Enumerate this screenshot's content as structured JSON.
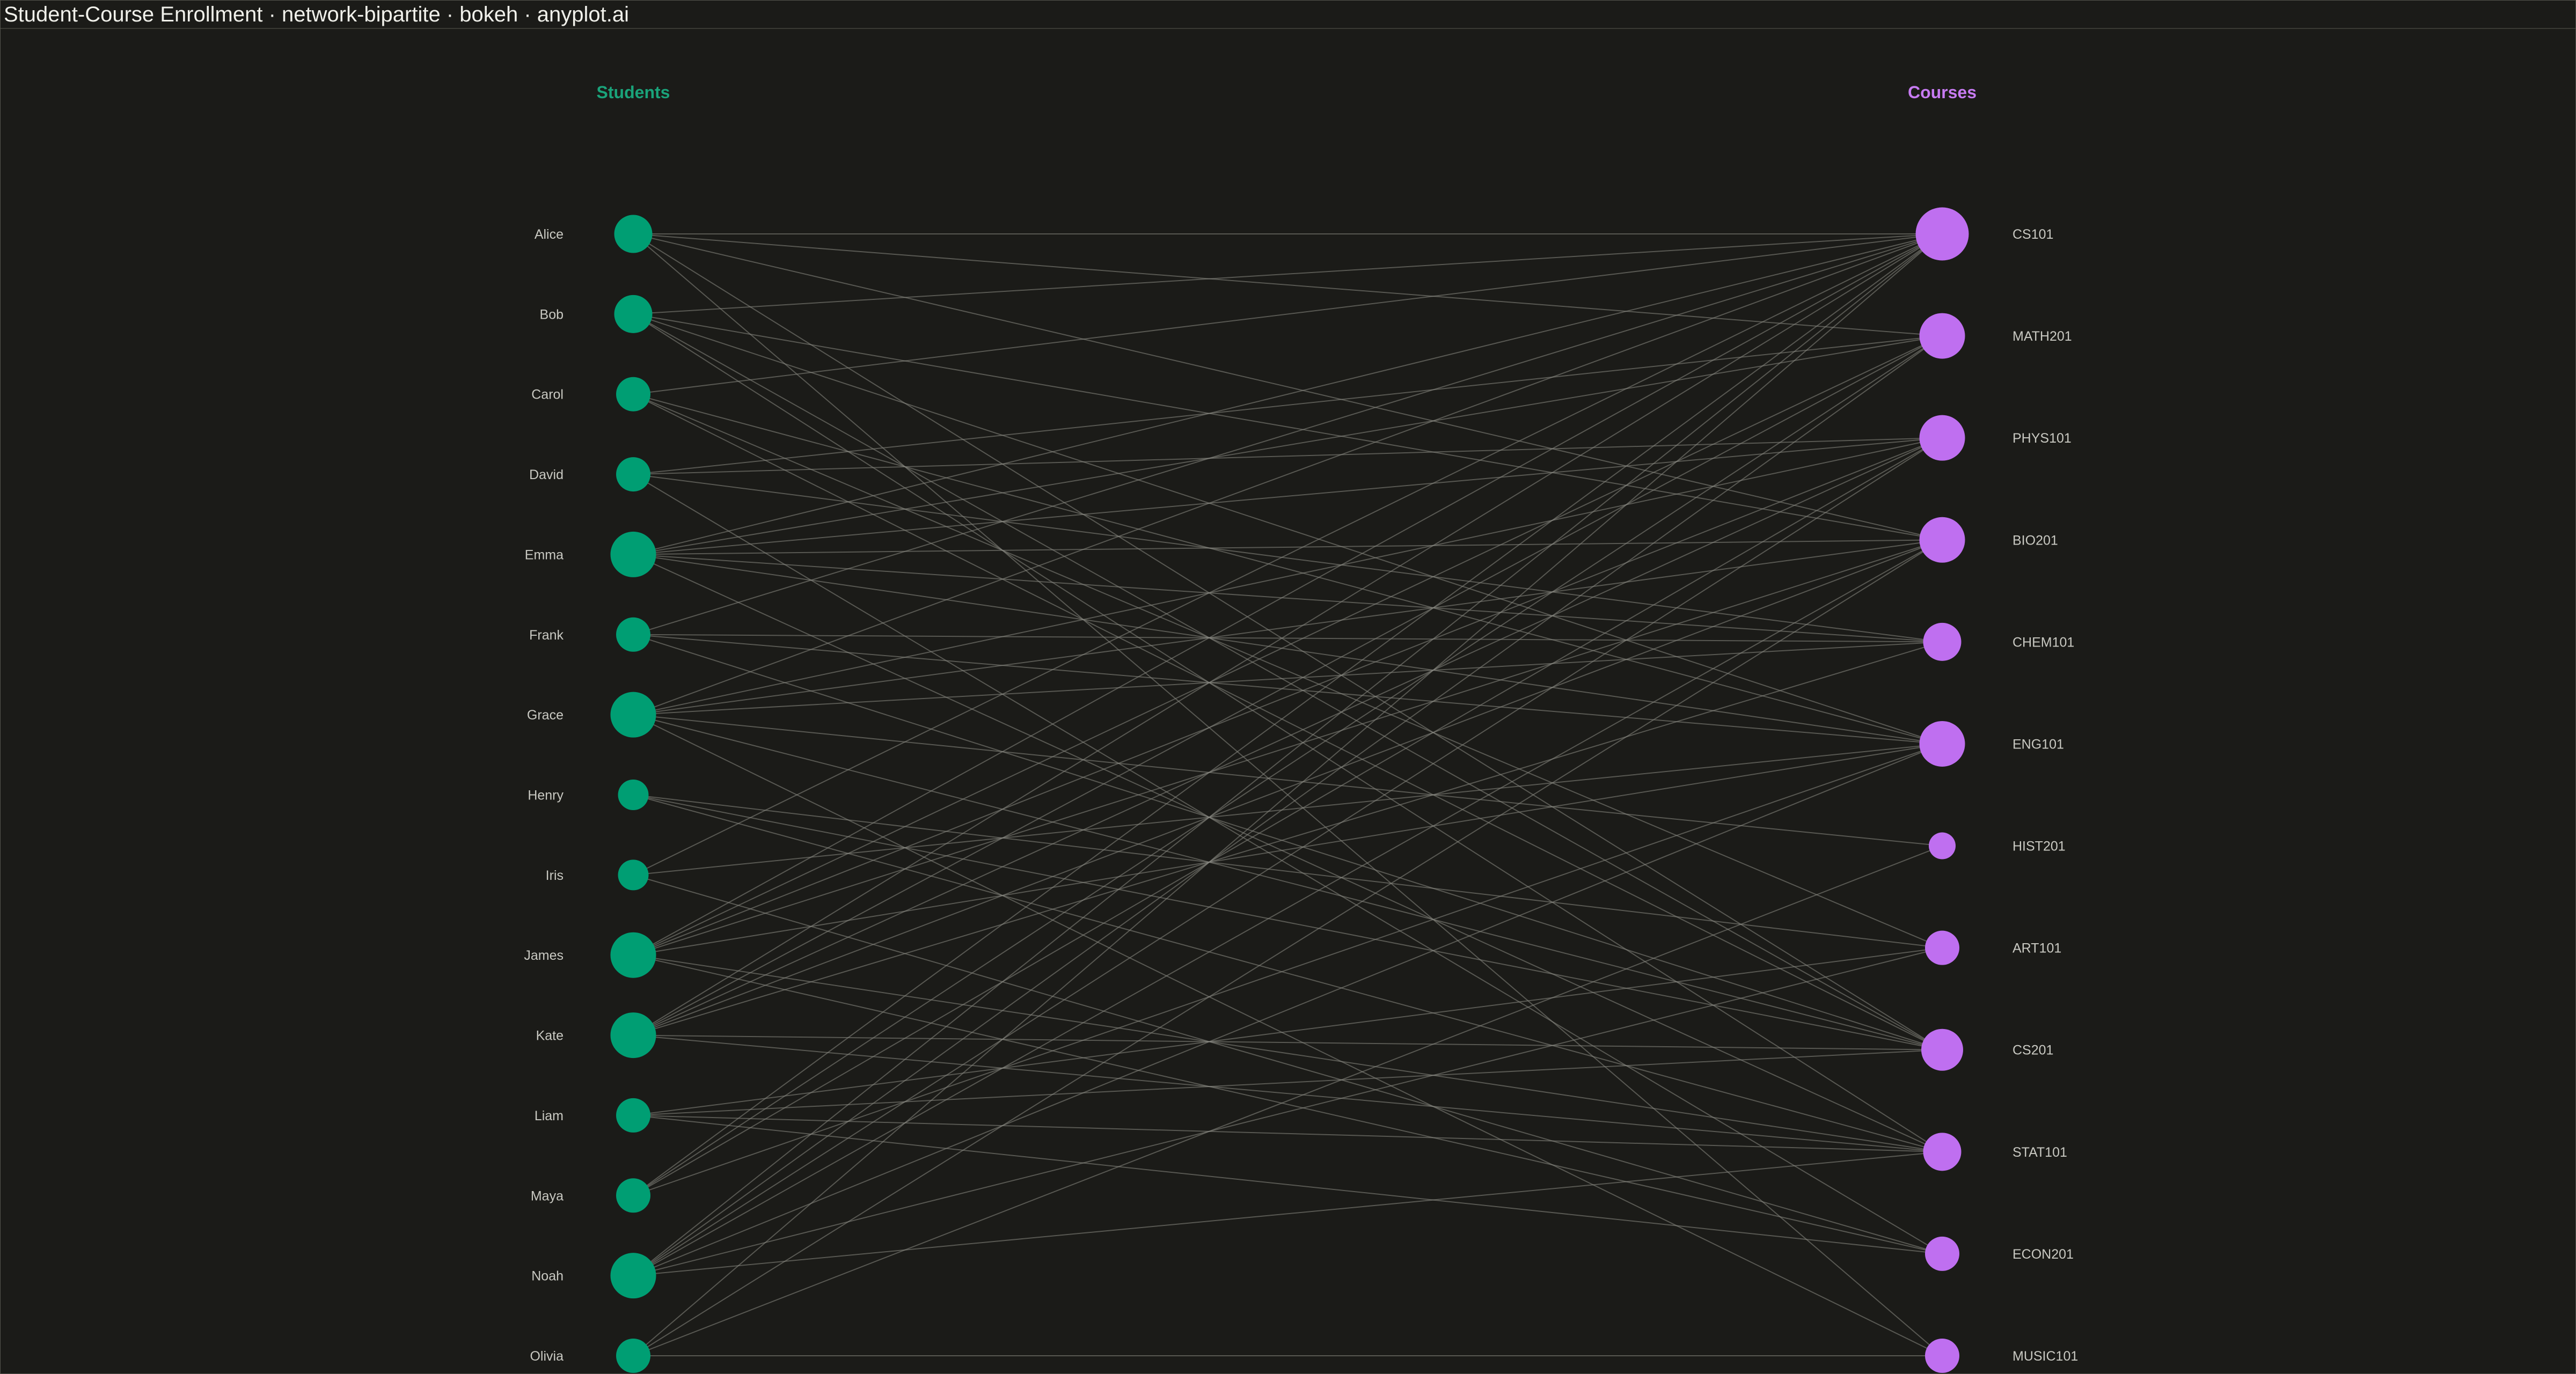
{
  "title": "Student-Course Enrollment · network-bipartite · bokeh · anyplot.ai",
  "colors": {
    "background": "#1b1b18",
    "student_node": "#009e73",
    "course_node": "#bf6ff0",
    "student_title": "#1aa37a",
    "course_title": "#c77bf2",
    "edge": "#8a8a84",
    "label": "#c9c9c2"
  },
  "students": {
    "title": "Students",
    "nodes": [
      {
        "name": "Alice",
        "degree": 5
      },
      {
        "name": "Bob",
        "degree": 5
      },
      {
        "name": "Carol",
        "degree": 4
      },
      {
        "name": "David",
        "degree": 4
      },
      {
        "name": "Emma",
        "degree": 7
      },
      {
        "name": "Frank",
        "degree": 4
      },
      {
        "name": "Grace",
        "degree": 7
      },
      {
        "name": "Henry",
        "degree": 3
      },
      {
        "name": "Iris",
        "degree": 3
      },
      {
        "name": "James",
        "degree": 7
      },
      {
        "name": "Kate",
        "degree": 7
      },
      {
        "name": "Liam",
        "degree": 4
      },
      {
        "name": "Maya",
        "degree": 4
      },
      {
        "name": "Noah",
        "degree": 7
      },
      {
        "name": "Olivia",
        "degree": 4
      }
    ]
  },
  "courses": {
    "title": "Courses",
    "nodes": [
      {
        "name": "CS101",
        "degree": 9
      },
      {
        "name": "MATH201",
        "degree": 7
      },
      {
        "name": "PHYS101",
        "degree": 7
      },
      {
        "name": "BIO201",
        "degree": 7
      },
      {
        "name": "CHEM101",
        "degree": 5
      },
      {
        "name": "ENG101",
        "degree": 7
      },
      {
        "name": "HIST201",
        "degree": 2
      },
      {
        "name": "ART101",
        "degree": 4
      },
      {
        "name": "CS201",
        "degree": 6
      },
      {
        "name": "STAT101",
        "degree": 5
      },
      {
        "name": "ECON201",
        "degree": 4
      },
      {
        "name": "MUSIC101",
        "degree": 4
      }
    ]
  },
  "edges": [
    [
      "Alice",
      "CS101"
    ],
    [
      "Alice",
      "MATH201"
    ],
    [
      "Alice",
      "BIO201"
    ],
    [
      "Alice",
      "CS201"
    ],
    [
      "Alice",
      "MUSIC101"
    ],
    [
      "Bob",
      "CS101"
    ],
    [
      "Bob",
      "BIO201"
    ],
    [
      "Bob",
      "ENG101"
    ],
    [
      "Bob",
      "CS201"
    ],
    [
      "Bob",
      "STAT101"
    ],
    [
      "Carol",
      "CS101"
    ],
    [
      "Carol",
      "ENG101"
    ],
    [
      "Carol",
      "ART101"
    ],
    [
      "Carol",
      "CS201"
    ],
    [
      "David",
      "MATH201"
    ],
    [
      "David",
      "PHYS101"
    ],
    [
      "David",
      "CHEM101"
    ],
    [
      "David",
      "ECON201"
    ],
    [
      "Emma",
      "CS101"
    ],
    [
      "Emma",
      "MATH201"
    ],
    [
      "Emma",
      "PHYS101"
    ],
    [
      "Emma",
      "BIO201"
    ],
    [
      "Emma",
      "CHEM101"
    ],
    [
      "Emma",
      "ENG101"
    ],
    [
      "Emma",
      "STAT101"
    ],
    [
      "Frank",
      "CS101"
    ],
    [
      "Frank",
      "CHEM101"
    ],
    [
      "Frank",
      "ENG101"
    ],
    [
      "Frank",
      "CS201"
    ],
    [
      "Grace",
      "CS101"
    ],
    [
      "Grace",
      "PHYS101"
    ],
    [
      "Grace",
      "BIO201"
    ],
    [
      "Grace",
      "CHEM101"
    ],
    [
      "Grace",
      "HIST201"
    ],
    [
      "Grace",
      "CS201"
    ],
    [
      "Grace",
      "MUSIC101"
    ],
    [
      "Henry",
      "ART101"
    ],
    [
      "Henry",
      "CS201"
    ],
    [
      "Henry",
      "STAT101"
    ],
    [
      "Iris",
      "CS101"
    ],
    [
      "Iris",
      "ENG101"
    ],
    [
      "Iris",
      "ECON201"
    ],
    [
      "James",
      "CS101"
    ],
    [
      "James",
      "MATH201"
    ],
    [
      "James",
      "PHYS101"
    ],
    [
      "James",
      "BIO201"
    ],
    [
      "James",
      "ENG101"
    ],
    [
      "James",
      "STAT101"
    ],
    [
      "James",
      "ECON201"
    ],
    [
      "Kate",
      "CS101"
    ],
    [
      "Kate",
      "MATH201"
    ],
    [
      "Kate",
      "PHYS101"
    ],
    [
      "Kate",
      "BIO201"
    ],
    [
      "Kate",
      "CHEM101"
    ],
    [
      "Kate",
      "CS201"
    ],
    [
      "Kate",
      "STAT101"
    ],
    [
      "Liam",
      "ART101"
    ],
    [
      "Liam",
      "CS201"
    ],
    [
      "Liam",
      "STAT101"
    ],
    [
      "Liam",
      "ECON201"
    ],
    [
      "Maya",
      "CS101"
    ],
    [
      "Maya",
      "MATH201"
    ],
    [
      "Maya",
      "PHYS101"
    ],
    [
      "Maya",
      "ENG101"
    ],
    [
      "Noah",
      "CS101"
    ],
    [
      "Noah",
      "MATH201"
    ],
    [
      "Noah",
      "PHYS101"
    ],
    [
      "Noah",
      "BIO201"
    ],
    [
      "Noah",
      "ENG101"
    ],
    [
      "Noah",
      "ART101"
    ],
    [
      "Noah",
      "STAT101"
    ],
    [
      "Olivia",
      "CS101"
    ],
    [
      "Olivia",
      "BIO201"
    ],
    [
      "Olivia",
      "HIST201"
    ],
    [
      "Olivia",
      "MUSIC101"
    ]
  ]
}
